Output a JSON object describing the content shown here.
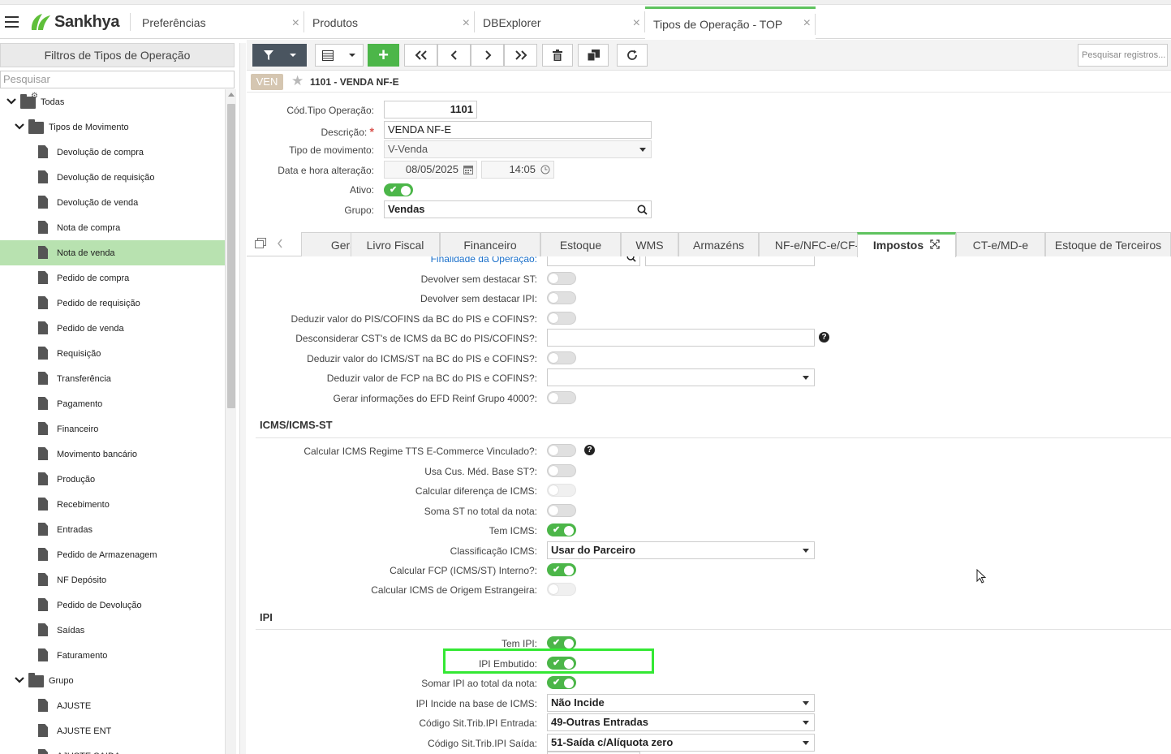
{
  "app": {
    "brand": "Sankhya",
    "tabs": [
      {
        "label": "Preferências"
      },
      {
        "label": "Produtos"
      },
      {
        "label": "DBExplorer"
      },
      {
        "label": "Tipos de Operação - TOP"
      }
    ]
  },
  "left": {
    "header": "Filtros de Tipos de Operação",
    "search_placeholder": "Pesquisar",
    "root": "Todas",
    "group1": "Tipos de Movimento",
    "items": [
      "Devolução de compra",
      "Devolução de requisição",
      "Devolução de venda",
      "Nota de compra",
      "Nota de venda",
      "Pedido de compra",
      "Pedido de requisição",
      "Pedido de venda",
      "Requisição",
      "Transferência",
      "Pagamento",
      "Financeiro",
      "Movimento bancário",
      "Produção",
      "Recebimento",
      "Entradas",
      "Pedido de Armazenagem",
      "NF Depósito",
      "Pedido de Devolução",
      "Saídas",
      "Faturamento"
    ],
    "selected": "Nota de venda",
    "group2": "Grupo",
    "group2_items": [
      "AJUSTE",
      "AJUSTE ENT",
      "AJUSTE SAIDA"
    ]
  },
  "toolbar": {
    "search_placeholder": "Pesquisar registros..."
  },
  "record": {
    "badge": "VEN",
    "title": "1101 - VENDA NF-E"
  },
  "form": {
    "cod_label": "Cód.Tipo Operação:",
    "cod_value": "1101",
    "desc_label": "Descrição:",
    "desc_value": "VENDA NF-E",
    "tipo_label": "Tipo de movimento:",
    "tipo_value": "V-Venda",
    "data_label": "Data e hora alteração:",
    "data_value": "08/05/2025",
    "hora_value": "14:05",
    "ativo_label": "Ativo:",
    "grupo_label": "Grupo:",
    "grupo_value": "Vendas"
  },
  "tabs": [
    "Geral",
    "Livro Fiscal",
    "Financeiro",
    "Estoque",
    "WMS",
    "Armazéns",
    "NF-e/NFC-e/CF-e",
    "Impostos",
    "CT-e/MD-e",
    "Estoque de Terceiros"
  ],
  "active_tab": "Impostos",
  "impostos": {
    "partial_label": "Finalidade da Operação:",
    "rows_top": [
      {
        "label": "Devolver sem destacar ST:",
        "on": false
      },
      {
        "label": "Devolver sem destacar IPI:",
        "on": false
      },
      {
        "label": "Deduzir valor do PIS/COFINS da BC do PIS e COFINS?:",
        "on": false
      },
      {
        "label": "Desconsiderar CST's de ICMS da BC do PIS/COFINS?:",
        "input": ""
      },
      {
        "label": "Deduzir valor do ICMS/ST na BC do PIS e COFINS?:",
        "on": false
      },
      {
        "label": "Deduzir valor de FCP na BC do PIS e COFINS?:",
        "select": ""
      },
      {
        "label": "Gerar informações do EFD Reinf Grupo 4000?:",
        "on": false
      }
    ],
    "section_icms": "ICMS/ICMS-ST",
    "rows_icms": [
      {
        "label": "Calcular ICMS Regime TTS E-Commerce Vinculado?:",
        "on": false
      },
      {
        "label": "Usa Cus. Méd. Base ST?:",
        "on": false
      },
      {
        "label": "Calcular diferença de ICMS:",
        "on": false,
        "disabled": true
      },
      {
        "label": "Soma ST no total da nota:",
        "on": false
      },
      {
        "label": "Tem ICMS:",
        "on": true
      },
      {
        "label": "Classificação ICMS:",
        "select": "Usar do Parceiro"
      },
      {
        "label": "Calcular FCP (ICMS/ST) Interno?:",
        "on": true
      },
      {
        "label": "Calcular ICMS de Origem Estrangeira:",
        "on": false,
        "disabled": true
      }
    ],
    "section_ipi": "IPI",
    "rows_ipi": [
      {
        "label": "Tem IPI:",
        "on": true
      },
      {
        "label": "IPI Embutido:",
        "on": true
      },
      {
        "label": "Somar IPI ao total da nota:",
        "on": true
      },
      {
        "label": "IPI Incide na base de ICMS:",
        "select": "Não Incide"
      },
      {
        "label": "Código Sit.Trib.IPI Entrada:",
        "select": "49-Outras Entradas"
      },
      {
        "label": "Código Sit.Trib.IPI Saída:",
        "select": "51-Saída c/Alíquota zero"
      }
    ]
  },
  "colors": {
    "accent_green": "#4cb649",
    "highlight": "#34e834",
    "selected_row": "#b8e2b0"
  }
}
